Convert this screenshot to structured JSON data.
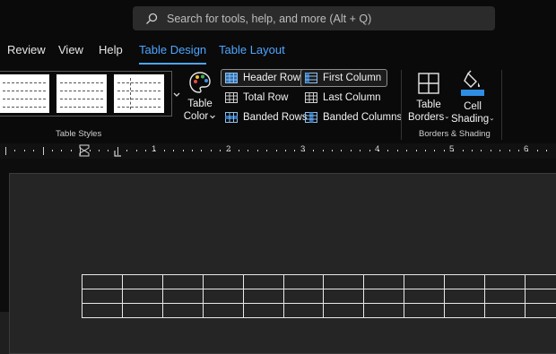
{
  "search": {
    "placeholder": "Search for tools, help, and more (Alt + Q)"
  },
  "tabs": [
    {
      "label": "Review",
      "active": false
    },
    {
      "label": "View",
      "active": false
    },
    {
      "label": "Help",
      "active": false
    },
    {
      "label": "Table Design",
      "active": true
    },
    {
      "label": "Table Layout",
      "active": false
    }
  ],
  "ribbon": {
    "table_styles_label": "Table Styles",
    "table_color": {
      "line1": "Table",
      "line2": "Color"
    },
    "style_options": {
      "header_row": {
        "label": "Header Row",
        "checked": true
      },
      "total_row": {
        "label": "Total Row",
        "checked": false
      },
      "banded_rows": {
        "label": "Banded Rows",
        "checked": false
      },
      "first_column": {
        "label": "First Column",
        "checked": true
      },
      "last_column": {
        "label": "Last Column",
        "checked": false
      },
      "banded_columns": {
        "label": "Banded Columns",
        "checked": false
      }
    },
    "table_borders": {
      "line1": "Table",
      "line2": "Borders"
    },
    "cell_shading": {
      "line1": "Cell",
      "line2": "Shading"
    },
    "borders_shading_label": "Borders & Shading"
  },
  "ruler": {
    "numbers": [
      "1",
      "2",
      "3",
      "4",
      "5",
      "6"
    ]
  },
  "colors": {
    "accent": "#4ea5ff",
    "shading_fill": "#2f8de4"
  }
}
